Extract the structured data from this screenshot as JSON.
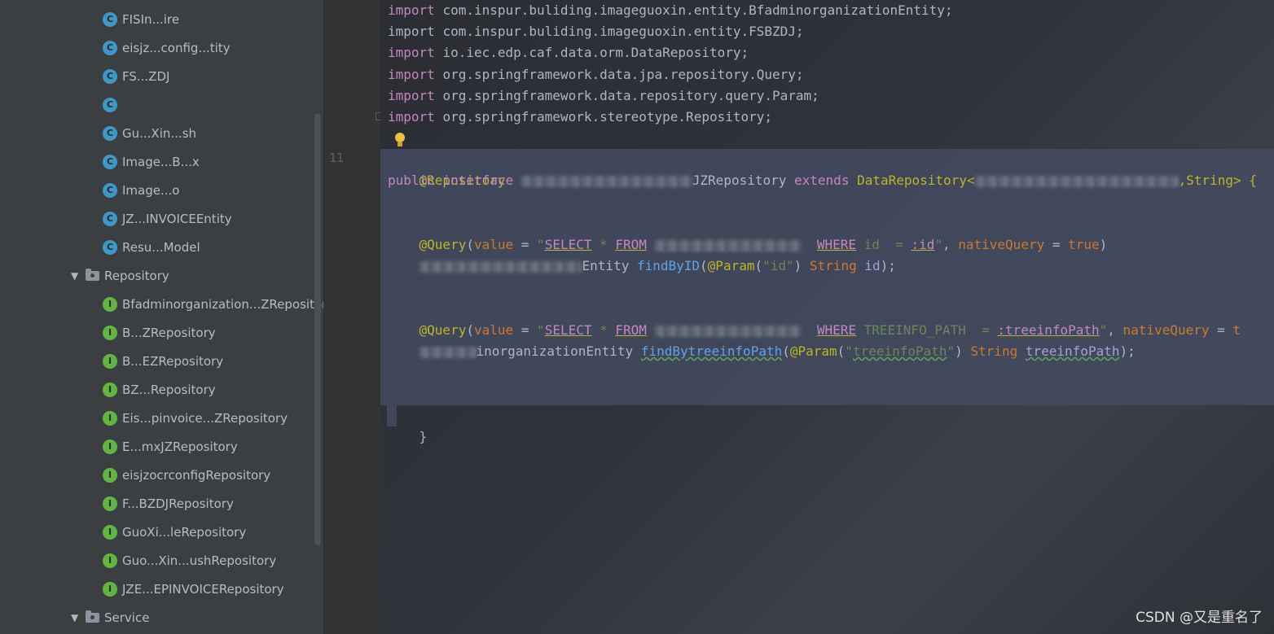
{
  "tree": {
    "class_items": [
      {
        "badge": "c",
        "label": "FISIn...ire"
      },
      {
        "badge": "c",
        "label": "eisjz...config...tity"
      },
      {
        "badge": "c",
        "label": "FS...ZDJ"
      },
      {
        "badge": "c",
        "label": ""
      },
      {
        "badge": "c",
        "label": "Gu...Xin...sh"
      },
      {
        "badge": "c",
        "label": "Image...B...x"
      },
      {
        "badge": "c",
        "label": "Image...o"
      },
      {
        "badge": "c",
        "label": "JZ...INVOICEEntity"
      },
      {
        "badge": "c",
        "label": "Resu...Model"
      }
    ],
    "repository_folder": "Repository",
    "repository_items": [
      {
        "badge": "I",
        "label": "Bfadminorganization...ZRepository"
      },
      {
        "badge": "I",
        "label": "B...ZRepository"
      },
      {
        "badge": "I",
        "label": "B...EZRepository"
      },
      {
        "badge": "I",
        "label": "BZ...Repository"
      },
      {
        "badge": "I",
        "label": "Eis...pinvoice...ZRepository"
      },
      {
        "badge": "I",
        "label": "E...mxJZRepository"
      },
      {
        "badge": "I",
        "label": "eisjzocrconfigRepository"
      },
      {
        "badge": "I",
        "label": "F...BZDJRepository"
      },
      {
        "badge": "I",
        "label": "GuoXi...leRepository"
      },
      {
        "badge": "I",
        "label": "Guo...Xin...ushRepository"
      },
      {
        "badge": "I",
        "label": "JZE...EPINVOICERepository"
      }
    ],
    "service_folder": "Service"
  },
  "gutter": {
    "line_number": "11"
  },
  "code": {
    "import_kw": "import",
    "imports": [
      {
        "pkg": "com.inspur.buliding.imageguoxin.entity.BfadminorganizationEntity;",
        "unused": false
      },
      {
        "pkg": "com.inspur.buliding.imageguoxin.entity.FSBZDJ;",
        "unused": true
      },
      {
        "pkg": "io.iec.edp.caf.data.orm.DataRepository;",
        "unused": false
      },
      {
        "pkg": "org.springframework.data.jpa.repository.Query;",
        "unused": false
      },
      {
        "pkg": "org.springframework.data.repository.query.Param;",
        "unused": false
      },
      {
        "pkg": "org.springframework.stereotype.Repository;",
        "unused": false
      }
    ],
    "repo_annotation": "@Repository",
    "public_kw": "public",
    "interface_kw": "interface",
    "interface_suffix": "JZRepository",
    "extends_kw": "extends",
    "base_type": "DataRepository<",
    "generic_tail": ",String> {",
    "query_annotation": "@Query",
    "value_kw": "value",
    "eq": " = ",
    "q1_open": "\"",
    "select_kw": "SELECT",
    "star": " * ",
    "from_kw": "FROM",
    "q1_mid": " bfadminorganization  ",
    "where_kw": "WHERE",
    "q1_cond": " id  = ",
    "q1_param": ":id",
    "q1_close": "\"",
    "native_kw": "nativeQuery",
    "true_kw": "true",
    "rparen": ")",
    "entity_suffix": "Entity",
    "m1_name": "findByID",
    "param_ann": "@Param",
    "m1_param_str": "\"id\"",
    "string_type": "String",
    "m1_arg": "id",
    "m_end": ");",
    "q2_cond": " TREEINFO_PATH  = ",
    "q2_param": ":treeinfoPath",
    "q2_tail": "t",
    "entity2_suffix": "inorganizationEntity",
    "m2_name": "findBytreeinfoPath",
    "m2_param_str": "treeinfoPath",
    "m2_arg": "treeinfoPath",
    "close_brace": "}"
  },
  "watermark": "CSDN @又是重名了",
  "colors": {
    "tree_bg": "#3c3f41",
    "editor_bg": "#2b2d33",
    "selection": "#444b60",
    "keyword": "#cc7832",
    "function": "#5ea3e6"
  }
}
